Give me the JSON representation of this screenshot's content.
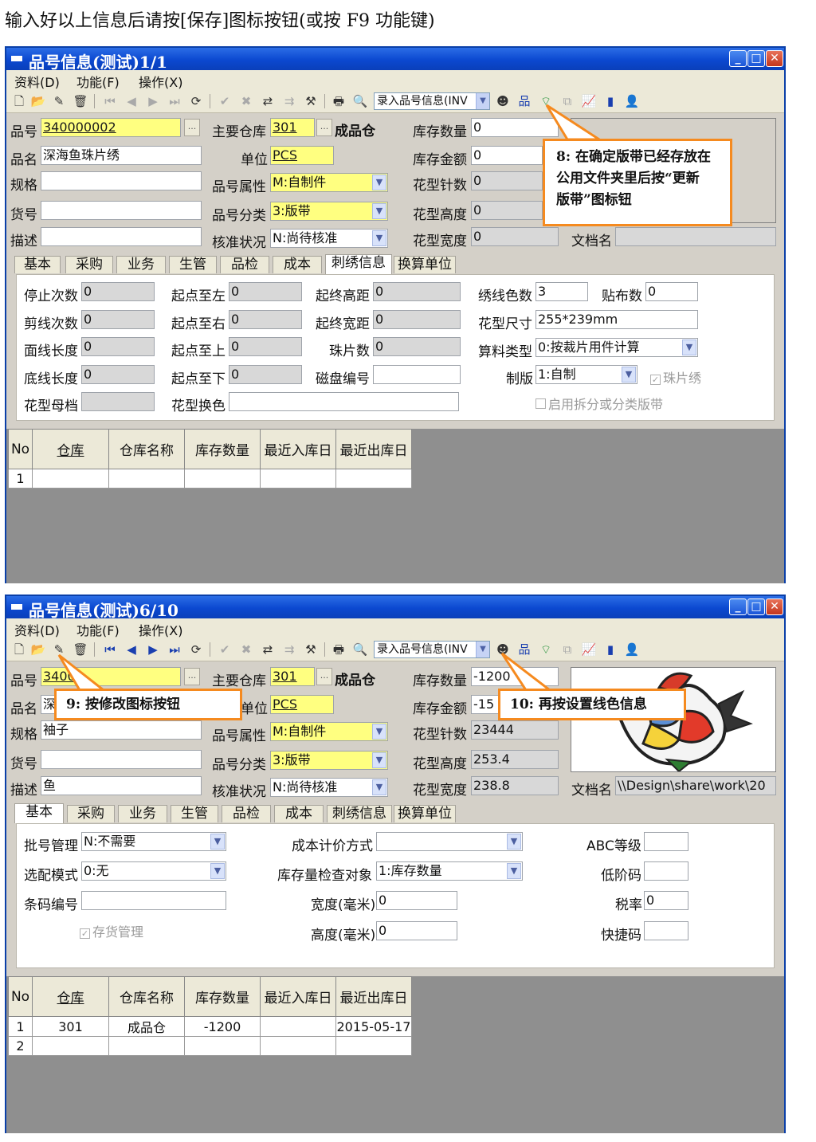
{
  "instruction_line": "输入好以上信息后请按[保存]图标按钮(或按 F9 功能键)",
  "window_controls": {
    "minimize": "_",
    "maximize": "□",
    "close": "✕"
  },
  "menu": [
    "资料(D)",
    "功能(F)",
    "操作(X)"
  ],
  "toolbar_combo": "录入品号信息(INV",
  "callouts": {
    "c8": [
      "8: 在确定版带已经存放在",
      "公用文件夹里后按“更新",
      "版带”图标钮"
    ],
    "c9": "9: 按修改图标按钮",
    "c10": "10: 再按设置线色信息"
  },
  "labels": {
    "part_no": "品号",
    "main_wh": "主要仓库",
    "stock_qty": "库存数量",
    "part_name": "品名",
    "unit": "单位",
    "stock_amt": "库存金额",
    "spec": "规格",
    "attr": "品号属性",
    "stitch": "花型针数",
    "goods_no": "货号",
    "category": "品号分类",
    "height": "花型高度",
    "desc": "描述",
    "approval": "核准状况",
    "width": "花型宽度",
    "doc_name": "文档名"
  },
  "tabs": [
    "基本",
    "采购",
    "业务",
    "生管",
    "品检",
    "成本",
    "刺绣信息",
    "换算单位"
  ],
  "grid_headers": [
    "No",
    "仓库",
    "仓库名称",
    "库存数量",
    "最近入库日",
    "最近出库日"
  ],
  "win1": {
    "title": "品号信息(测试)1/1",
    "fields": {
      "part_no": "340000002",
      "main_wh": "301",
      "wh_name": "成品仓",
      "stock_qty": "0",
      "part_name": "深海鱼珠片绣",
      "unit": "PCS",
      "stock_amt": "0",
      "spec": "",
      "attr": "M:自制件",
      "stitch": "0",
      "goods_no": "",
      "category": "3:版带",
      "height": "0",
      "desc": "",
      "approval": "N:尚待核准",
      "width": "0",
      "doc_name": ""
    },
    "embroidery": {
      "labels": {
        "stops": "停止次数",
        "cuts": "剪线次数",
        "top_len": "面线长度",
        "bottom_len": "底线长度",
        "mother": "花型母档",
        "start_left": "起点至左",
        "start_right": "起点至右",
        "start_top": "起点至上",
        "start_bottom": "起点至下",
        "color_change": "花型换色",
        "end_height": "起终高距",
        "end_width": "起终宽距",
        "beads": "珠片数",
        "disk_no": "磁盘编号",
        "thread_colors": "绣线色数",
        "patches": "贴布数",
        "size": "花型尺寸",
        "calc_type": "算料类型",
        "plate": "制版",
        "bead_embroidery": "珠片绣",
        "split_enable": "启用拆分或分类版带"
      },
      "values": {
        "stops": "0",
        "cuts": "0",
        "top_len": "0",
        "bottom_len": "0",
        "mother": "",
        "start_left": "0",
        "start_right": "0",
        "start_top": "0",
        "start_bottom": "0",
        "color_change": "",
        "end_height": "0",
        "end_width": "0",
        "beads": "0",
        "disk_no": "",
        "thread_colors": "3",
        "patches": "0",
        "size": "255*239mm",
        "calc_type": "0:按裁片用件计算",
        "plate": "1:自制"
      }
    },
    "rows": [
      [
        "1",
        "",
        "",
        "",
        "",
        ""
      ]
    ]
  },
  "win2": {
    "title": "品号信息(测试)6/10",
    "fields": {
      "part_no": "34000",
      "main_wh": "301",
      "wh_name": "成品仓",
      "stock_qty": "-1200",
      "part_name": "深",
      "unit": "PCS",
      "stock_amt": "-15",
      "spec": "袖子",
      "attr": "M:自制件",
      "stitch": "23444",
      "goods_no": "",
      "category": "3:版带",
      "height": "253.4",
      "desc": "鱼",
      "approval": "N:尚待核准",
      "width": "238.8",
      "doc_name": "\\\\Design\\share\\work\\20"
    },
    "basic": {
      "labels": {
        "batch": "批号管理",
        "option": "选配模式",
        "barcode": "条码编号",
        "inventory": "存货管理",
        "cost_method": "成本计价方式",
        "stock_check": "库存量检查对象",
        "width_mm": "宽度(毫米)",
        "height_mm": "高度(毫米)",
        "abc": "ABC等级",
        "low_code": "低阶码",
        "tax": "税率",
        "quick": "快捷码"
      },
      "values": {
        "batch": "N:不需要",
        "option": "0:无",
        "barcode": "",
        "cost_method": "",
        "stock_check": "1:库存数量",
        "width_mm": "0",
        "height_mm": "0",
        "abc": "",
        "low_code": "",
        "tax": "0",
        "quick": ""
      }
    },
    "rows": [
      [
        "1",
        "301",
        "成品仓",
        "-1200",
        "",
        "2015-05-17"
      ],
      [
        "2",
        "",
        "",
        "",
        "",
        ""
      ]
    ]
  }
}
